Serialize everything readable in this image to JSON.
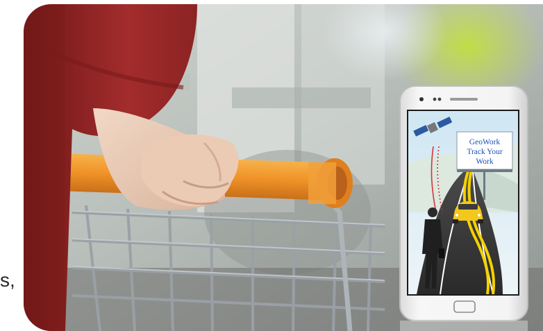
{
  "edge_text": "s,",
  "billboard": {
    "line1": "GeoWork",
    "line2": "Track Your",
    "line3": "Work"
  },
  "colors": {
    "cart_handle": "#f29a2e",
    "sleeve": "#9e2a2a",
    "car": "#f2c81e",
    "road_lines": "#f5d100",
    "phone_body": "#f2f2f2"
  },
  "icons": [
    "satellite-icon",
    "person-icon",
    "car-icon"
  ]
}
